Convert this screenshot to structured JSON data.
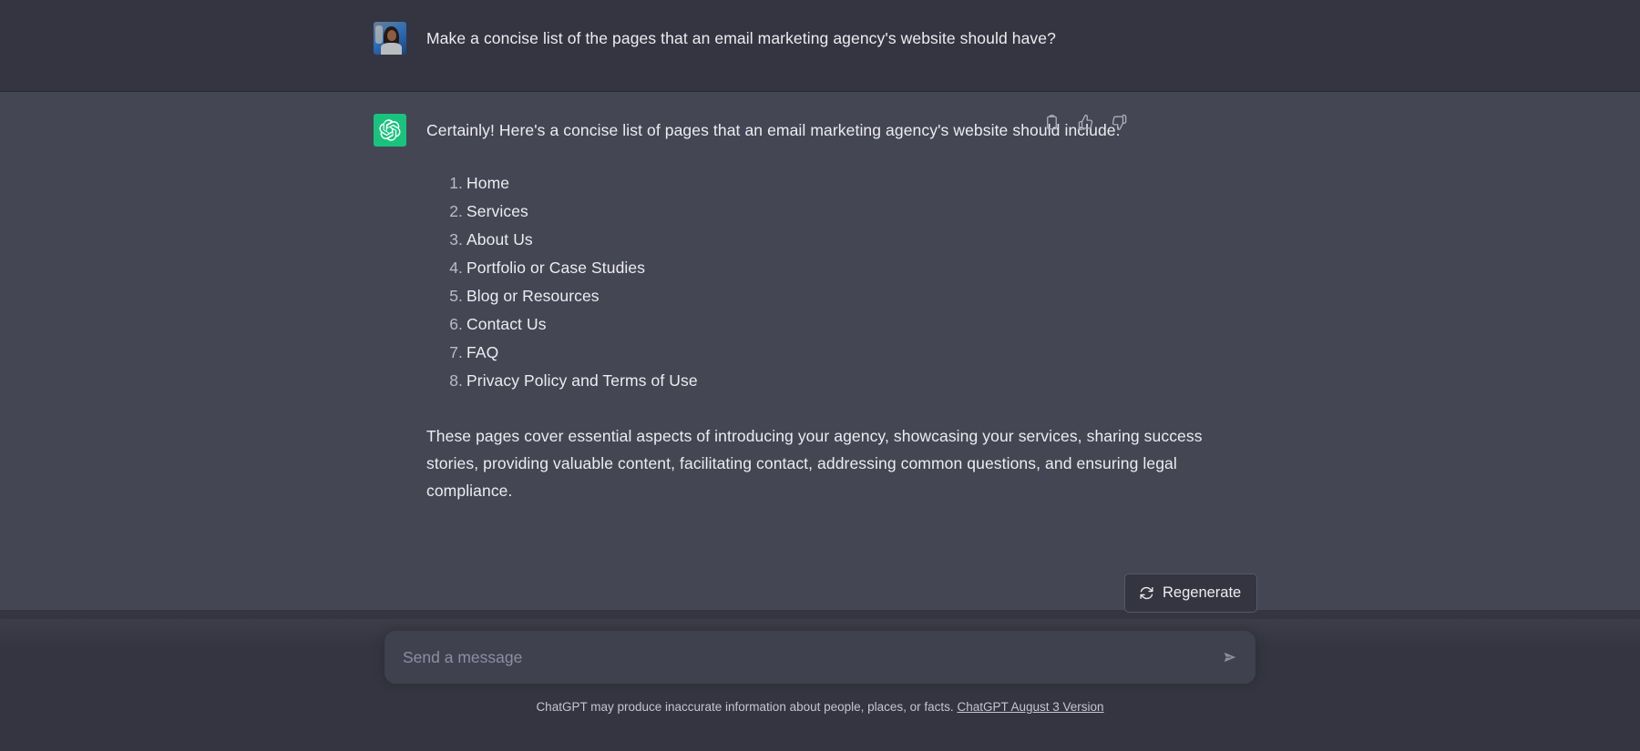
{
  "colors": {
    "user_row_bg": "#343541",
    "assistant_row_bg": "#444654",
    "accent_green": "#19c37d",
    "text_primary": "#ececf1",
    "text_muted": "#8e8ea0",
    "composer_bg": "#40414f"
  },
  "conversation": {
    "user_message": {
      "avatar_name": "user-avatar-photo",
      "text": "Make a concise list of the pages that an email marketing agency's website should have?"
    },
    "assistant_message": {
      "avatar_name": "chatgpt-logo",
      "intro": "Certainly! Here's a concise list of pages that an email marketing agency's website should include:",
      "list": [
        "Home",
        "Services",
        "About Us",
        "Portfolio or Case Studies",
        "Blog or Resources",
        "Contact Us",
        "FAQ",
        "Privacy Policy and Terms of Use"
      ],
      "closing": "These pages cover essential aspects of introducing your agency, showcasing your services, sharing success stories, providing valuable content, facilitating contact, addressing common questions, and ensuring legal compliance.",
      "actions": [
        {
          "name": "copy-icon",
          "label": "Copy"
        },
        {
          "name": "thumbs-up-icon",
          "label": "Good response"
        },
        {
          "name": "thumbs-down-icon",
          "label": "Bad response"
        }
      ]
    }
  },
  "regenerate": {
    "label": "Regenerate",
    "icon": "refresh-icon"
  },
  "composer": {
    "placeholder": "Send a message",
    "value": "",
    "send_icon": "send-icon"
  },
  "footer": {
    "disclaimer": "ChatGPT may produce inaccurate information about people, places, or facts.",
    "version_link": "ChatGPT August 3 Version"
  }
}
